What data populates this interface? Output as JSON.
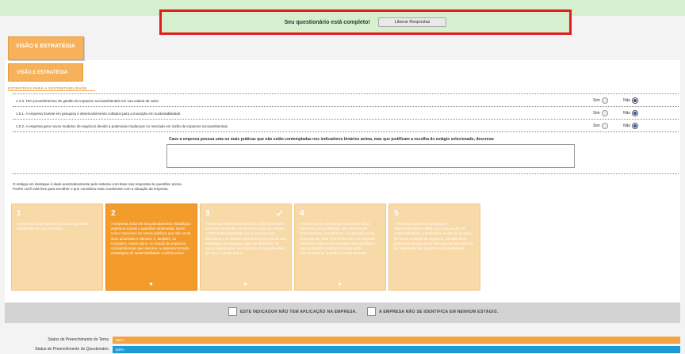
{
  "banner": {
    "message": "Seu questionário está completo!",
    "button": "Liberar Respostas"
  },
  "tabs": {
    "outer": "VISÃO E ESTRATÉGIA",
    "inner": "VISÃO E ESTRATÉGIA"
  },
  "section": "ESTRATÉGIA PARA A SUSTENTABILIDADE",
  "questions": [
    {
      "text": "1.4.3. Tem procedimentos de gestão de impactos socioambientais em sua cadeia de valor:",
      "sim": "Sim",
      "nao": "Não",
      "selected": "nao"
    },
    {
      "text": "1.5.1. A empresa investe em pesquisa e desenvolvimento voltados para a inovação em sustentabilidade.",
      "sim": "Sim",
      "nao": "Não",
      "selected": "nao"
    },
    {
      "text": "1.5.2. A empresa gera novos modelos de negócios devido a potenciais mudanças no mercado em razão de impactos socioambientais.",
      "sim": "Sim",
      "nao": "Não",
      "selected": "nao"
    }
  ],
  "caso": "Caso a empresa possua uma ou mais práticas que não estão contempladas nos indicadores binários acima, mas que justificam a escolha do estágio selecionado, descreva:",
  "info": [
    "O estágio em destaque é dado automaticamente pelo sistema com base nas respostas às questões acima.",
    "Porém você está livre para escolher o que considera mais condizente com a situação da empresa."
  ],
  "stages": [
    {
      "num": "1",
      "text": "A empresa inclui aspectos sociais e questões ambientais em sua estratégia.",
      "active": false,
      "check": false,
      "arrow": false
    },
    {
      "num": "2",
      "text": "A empresa inclui em seu planejamento estratégico aspectos sociais e questões ambientais, assim como interesses de outros públicos que não os de seus acionistas e clientes; e, também, os considera, nesse plano, no estudo de impactos socioambientais que assume, a empresa formula estratégias de sustentabilidade a médio prazo.",
      "active": true,
      "check": false,
      "arrow": true
    },
    {
      "num": "3",
      "text": "A empresa implementa políticas, procedimentos e sistemas de gestão, em primeiro lugar, ao integrar a RSE/Sustentabilidade em seus processos decisórios e ao torná-la elemento essencial de sua estratégia; em segundo lugar, ao identificar os riscos relacionados aos impactos socioambientais de curto e médio prazo.",
      "active": false,
      "check": true,
      "arrow": true
    },
    {
      "num": "4",
      "text": "A empresa, em um primeiro momento, inclui aspectos socioambientais nas decisões de financiamento, investimento ou operação e nas projeções de valor econômico. Em um segundo momento, elabora um planejamento estratégico que contempla cenários de longo prazo relacionados às questões socioambientais.",
      "active": false,
      "check": false,
      "arrow": true
    },
    {
      "num": "5",
      "text": "A empresa investe em pesquisa e desenvolvimento voltado para a inovação em sustentabilidade, e estabelece metas de geração de novos modelos de negócios, considerando potenciais mudanças de mercado em decorrência do tratamento das questões socioambientais.",
      "active": false,
      "check": false,
      "arrow": false
    }
  ],
  "checkboxes": {
    "no_application": "ESTE INDICADOR NÃO TEM APLICAÇÃO NA EMPRESA.",
    "no_stage": "A EMPRESA NÃO SE IDENTIFICA EM NENHUM ESTÁGIO."
  },
  "status": [
    {
      "label": "Status de Preenchimento do Tema",
      "pct": "100%",
      "value": 1.0,
      "color": "#f4a340"
    },
    {
      "label": "Status de Preenchimento do Questionário",
      "pct": "100%",
      "value": 1.0,
      "color": "#1d9bd6"
    }
  ]
}
